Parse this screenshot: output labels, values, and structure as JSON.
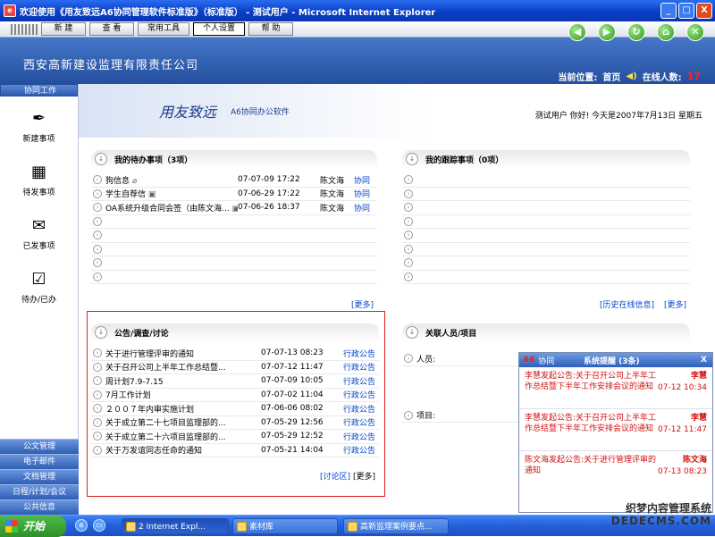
{
  "window": {
    "title": "欢迎使用《用友致远A6协同管理软件标准版》（标准版） - 测试用户 - Microsoft Internet Explorer",
    "min": "_",
    "max": "□",
    "close": "X"
  },
  "toolbar": {
    "buttons": [
      "新 建",
      "查 看",
      "常用工具",
      "个人设置",
      "帮 助"
    ]
  },
  "header": {
    "company": "西安高新建设监理有限责任公司",
    "location_label": "当前位置:",
    "location_value": "首页",
    "online_label": "在线人数:",
    "online_count": "17"
  },
  "sidebar": {
    "section": "协同工作",
    "items": [
      "新建事项",
      "待发事项",
      "已发事项",
      "待办/已办"
    ],
    "bottom": [
      "公文管理",
      "电子邮件",
      "文档管理",
      "日程/计划/会议",
      "公共信息"
    ]
  },
  "banner": {
    "logo": "用友致远",
    "sub": "A6协同办公软件",
    "greeting": "测试用户  你好! 今天是2007年7月13日  星期五"
  },
  "todo": {
    "title": "我的待办事项（3项）",
    "rows": [
      {
        "title": "狗信息",
        "date": "07-07-09 17:22",
        "user": "陈文海",
        "link": "协同"
      },
      {
        "title": "学生自荐信",
        "date": "07-06-29 17:22",
        "user": "陈文海",
        "link": "协同"
      },
      {
        "title": "OA系统升级合同会签（由陈文海...",
        "date": "07-06-26 18:37",
        "user": "陈文海",
        "link": "协同"
      }
    ],
    "more": "[更多]"
  },
  "tracking": {
    "title": "我的跟踪事项（0项）",
    "history": "[历史在线信息]",
    "more": "[更多]"
  },
  "notices": {
    "title": "公告/调查/讨论",
    "rows": [
      {
        "title": "关于进行管理评审的通知",
        "date": "07-07-13 08:23",
        "link": "行政公告"
      },
      {
        "title": "关于召开公司上半年工作总结暨...",
        "date": "07-07-12 11:47",
        "link": "行政公告"
      },
      {
        "title": "周计划7.9-7.15",
        "date": "07-07-09 10:05",
        "link": "行政公告"
      },
      {
        "title": "7月工作计划",
        "date": "07-07-02 11:04",
        "link": "行政公告"
      },
      {
        "title": "２００７年内审实施计划",
        "date": "07-06-06 08:02",
        "link": "行政公告"
      },
      {
        "title": "关于成立第二十七项目监理部的...",
        "date": "07-05-29 12:56",
        "link": "行政公告"
      },
      {
        "title": "关于成立第二十六项目监理部的...",
        "date": "07-05-29 12:52",
        "link": "行政公告"
      },
      {
        "title": "关于万发谊同志任命的通知",
        "date": "07-05-21 14:04",
        "link": "行政公告"
      }
    ],
    "discuss": "[讨论区]",
    "more": "[更多]"
  },
  "related": {
    "title": "关联人员/项目",
    "person_label": "人员:",
    "project_label": "项目:"
  },
  "popup": {
    "brand": "A6",
    "brand_text": "协同",
    "title": "系统提醒 (3条)",
    "close": "X",
    "items": [
      {
        "msg": "李慧发起公告:关于召开公司上半年工作总结暨下半年工作安排会议的通知",
        "sender": "李慧",
        "time": "07-12 10:34"
      },
      {
        "msg": "李慧发起公告:关于召开公司上半年工作总结暨下半年工作安排会议的通知",
        "sender": "李慧",
        "time": "07-12 11:47"
      },
      {
        "msg": "陈文海发起公告:关于进行管理评审的通知",
        "sender": "陈文海",
        "time": "07-13 08:23"
      }
    ]
  },
  "taskbar": {
    "start": "开始",
    "tasks": [
      "2 Internet Expl...",
      "素材库",
      "高新监理案例要点..."
    ]
  },
  "watermark": {
    "line1": "织梦内容管理系统",
    "line2": "DEDECMS.COM"
  },
  "colors": {
    "accent": "#2d5cb0",
    "alert": "#d01010",
    "link": "#0044cc"
  }
}
